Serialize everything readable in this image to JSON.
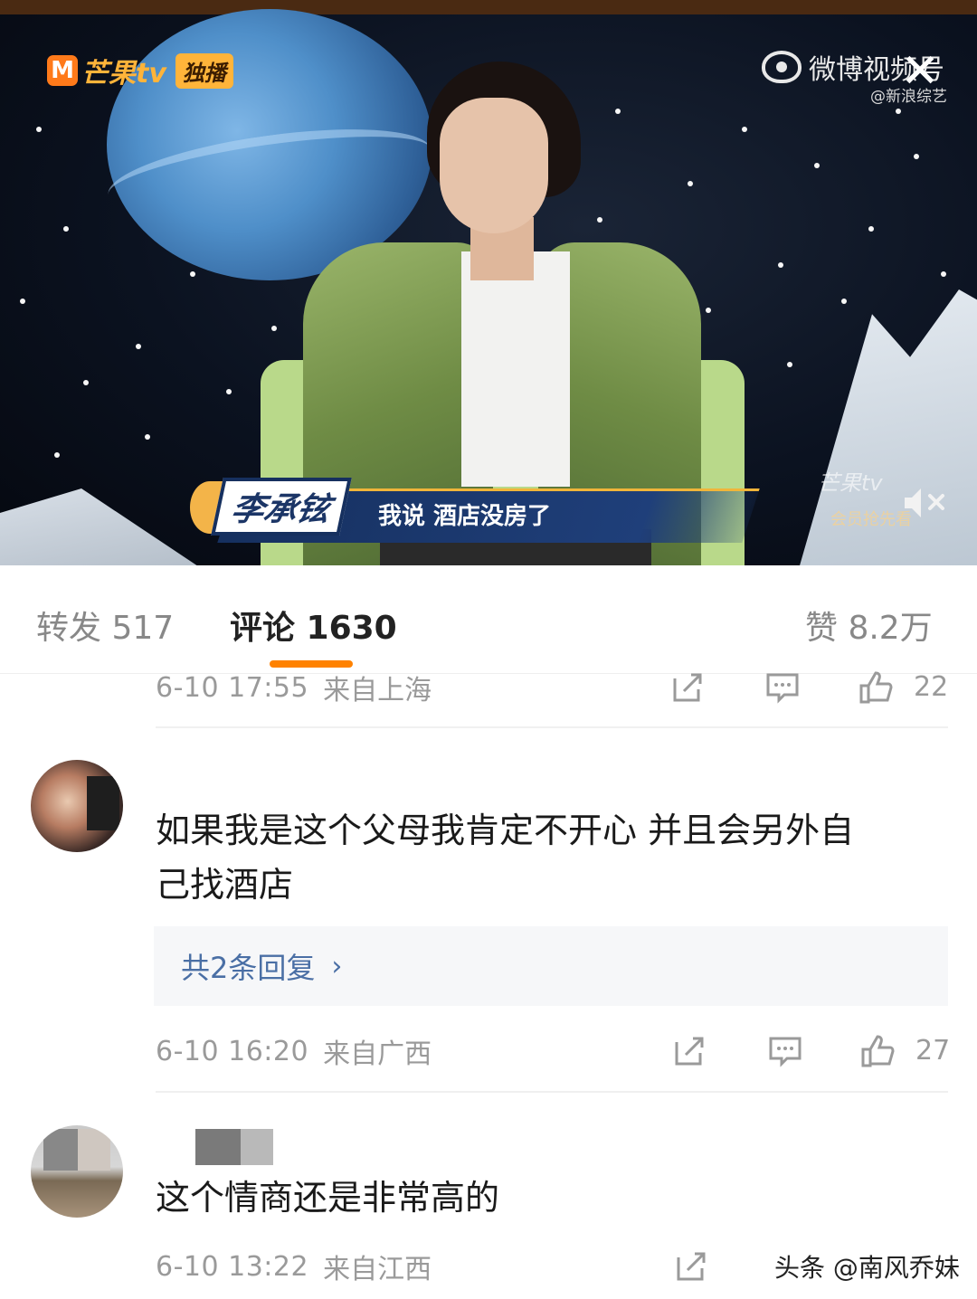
{
  "video": {
    "brand_logo_letter": "M",
    "brand_logo_text": "芒果tv",
    "brand_tag": "独播",
    "weibo_label": "微博视频号",
    "weibo_sub": "@新浪综艺",
    "speaker_name": "李承铉",
    "subtitle": "我说 酒店没房了",
    "mgtv_watermark": "芒果tv",
    "mgtv_watermark_sub": "会员抢先看"
  },
  "tabs": {
    "repost": "转发 517",
    "comments": "评论 1630",
    "likes": "赞 8.2万",
    "active_color": "#ff8200"
  },
  "comments": [
    {
      "time": "6-10 17:55",
      "location": "来自上海",
      "likes": "22"
    },
    {
      "text_line1": "如果我是这个父母我肯定不开心  并且会另外自",
      "text_line2": "己找酒店",
      "replies": "共2条回复",
      "time": "6-10 16:20",
      "location": "来自广西",
      "likes": "27"
    },
    {
      "text": "这个情商还是非常高的",
      "time": "6-10 13:22",
      "location": "来自江西"
    }
  ],
  "footer": {
    "watermark": "头条 @南风乔妹"
  },
  "icons": [
    "close-icon",
    "mute-icon",
    "share-icon",
    "comment-icon",
    "like-icon",
    "chevron-right-icon",
    "weibo-icon"
  ]
}
